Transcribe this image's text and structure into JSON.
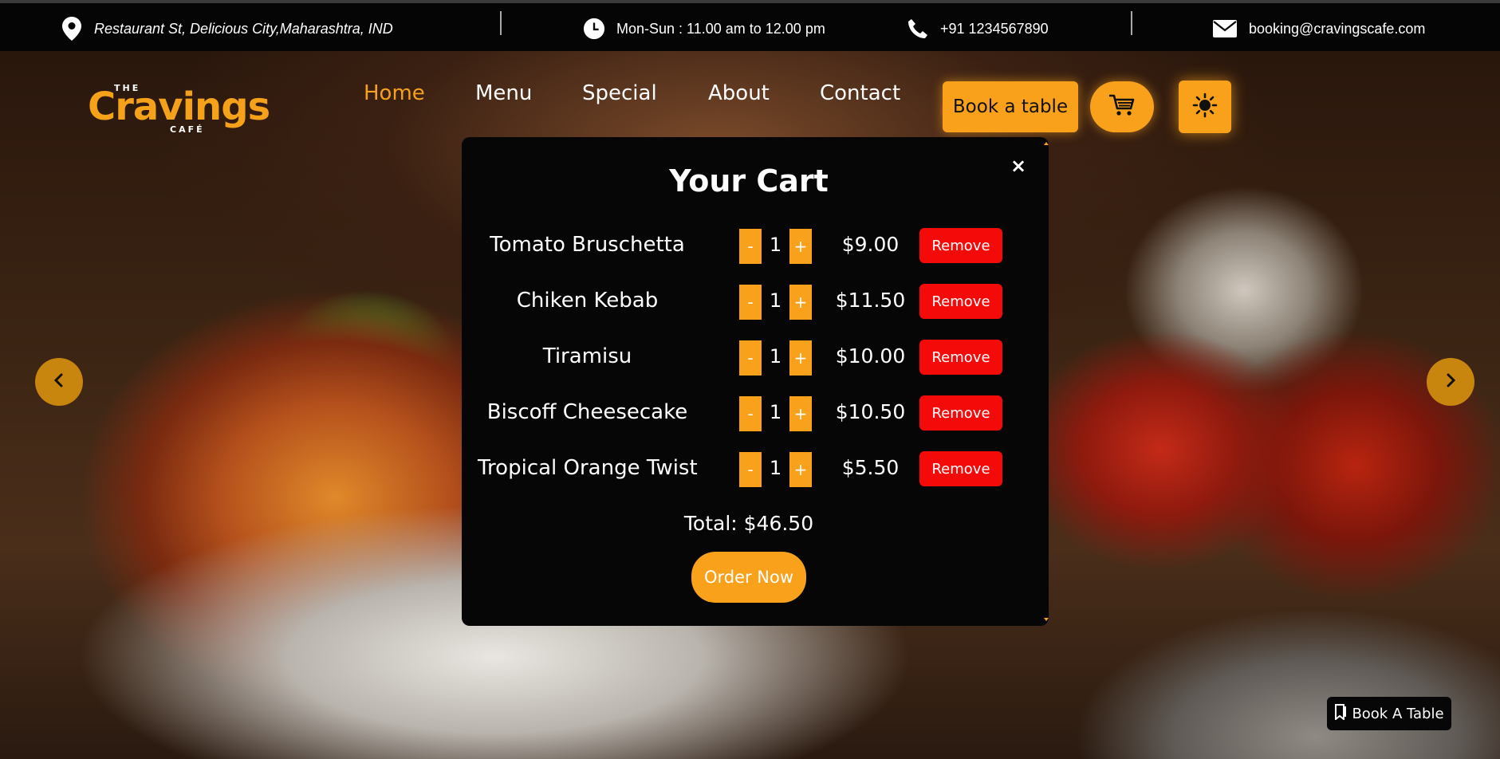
{
  "topbar": {
    "address": "Restaurant St, Delicious City,Maharashtra, IND",
    "hours": "Mon-Sun : 11.00 am to 12.00 pm",
    "phone": "+91 1234567890",
    "email": "booking@cravingscafe.com",
    "icons": [
      "location-pin-icon",
      "clock-icon",
      "phone-icon",
      "mail-icon"
    ]
  },
  "logo": {
    "the": "THE",
    "brand": "Cravings",
    "cafe": "CAFÉ"
  },
  "nav": {
    "items": [
      "Home",
      "Menu",
      "Special",
      "About",
      "Contact"
    ],
    "active": "Home"
  },
  "header": {
    "book_label": "Book a table",
    "cart_icon": "cart-icon",
    "theme_icon": "sun-icon"
  },
  "colors": {
    "accent": "#f9a11b",
    "danger": "#f50a0a",
    "bar": "#050505"
  },
  "cart": {
    "title": "Your Cart",
    "close": "×",
    "minus": "-",
    "plus": "+",
    "remove_label": "Remove",
    "items": [
      {
        "name": "Tomato Bruschetta",
        "qty": "1",
        "price": "$9.00"
      },
      {
        "name": "Chiken Kebab",
        "qty": "1",
        "price": "$11.50"
      },
      {
        "name": "Tiramisu",
        "qty": "1",
        "price": "$10.00"
      },
      {
        "name": "Biscoff Cheesecake",
        "qty": "1",
        "price": "$10.50"
      },
      {
        "name": "Tropical Orange Twist",
        "qty": "1",
        "price": "$5.50"
      }
    ],
    "total": "Total: $46.50",
    "order_label": "Order Now"
  },
  "float_book": {
    "label": "Book A Table",
    "icon": "bookmark-icon"
  }
}
